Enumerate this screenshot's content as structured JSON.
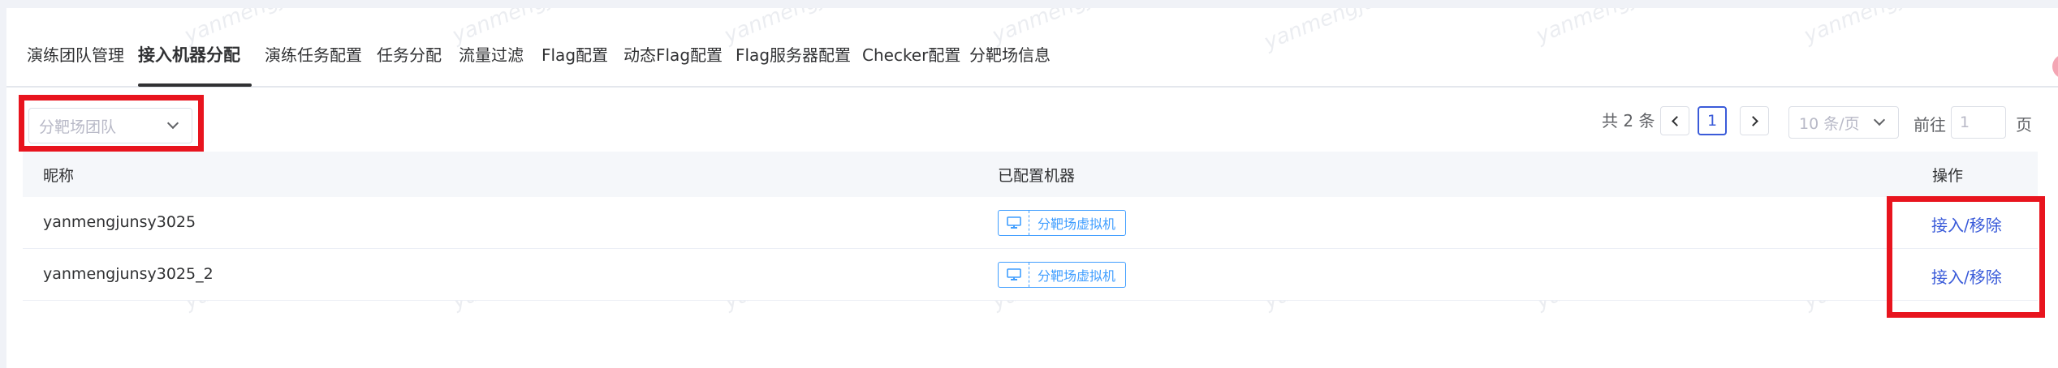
{
  "tabs": [
    {
      "label": "演练团队管理"
    },
    {
      "label": "接入机器分配"
    },
    {
      "label": "演练任务配置"
    },
    {
      "label": "任务分配"
    },
    {
      "label": "流量过滤"
    },
    {
      "label": "Flag配置"
    },
    {
      "label": "动态Flag配置"
    },
    {
      "label": "Flag服务器配置"
    },
    {
      "label": "Checker配置"
    },
    {
      "label": "分靶场信息"
    }
  ],
  "active_tab": "接入机器分配",
  "filter": {
    "placeholder": "分靶场团队"
  },
  "pagination": {
    "total_text": "共 2 条",
    "current_page": "1",
    "page_size": "10 条/页",
    "goto_label": "前往",
    "goto_value": "1",
    "page_suffix": "页"
  },
  "table": {
    "headers": {
      "name": "昵称",
      "machines": "已配置机器",
      "actions": "操作"
    },
    "rows": [
      {
        "name": "yanmengjunsy3025",
        "machine_tag": "分靶场虚拟机",
        "action": "接入/移除"
      },
      {
        "name": "yanmengjunsy3025_2",
        "machine_tag": "分靶场虚拟机",
        "action": "接入/移除"
      }
    ]
  },
  "watermark": "yanmengjui",
  "icons": {
    "tag_icon": "monitor-icon",
    "select_chevron": "chevron-down-icon",
    "prev": "chevron-left-icon",
    "next": "chevron-right-icon"
  },
  "colors": {
    "accent": "#3a5bd9",
    "tag": "#409eff",
    "highlight_box": "#e8141e"
  }
}
